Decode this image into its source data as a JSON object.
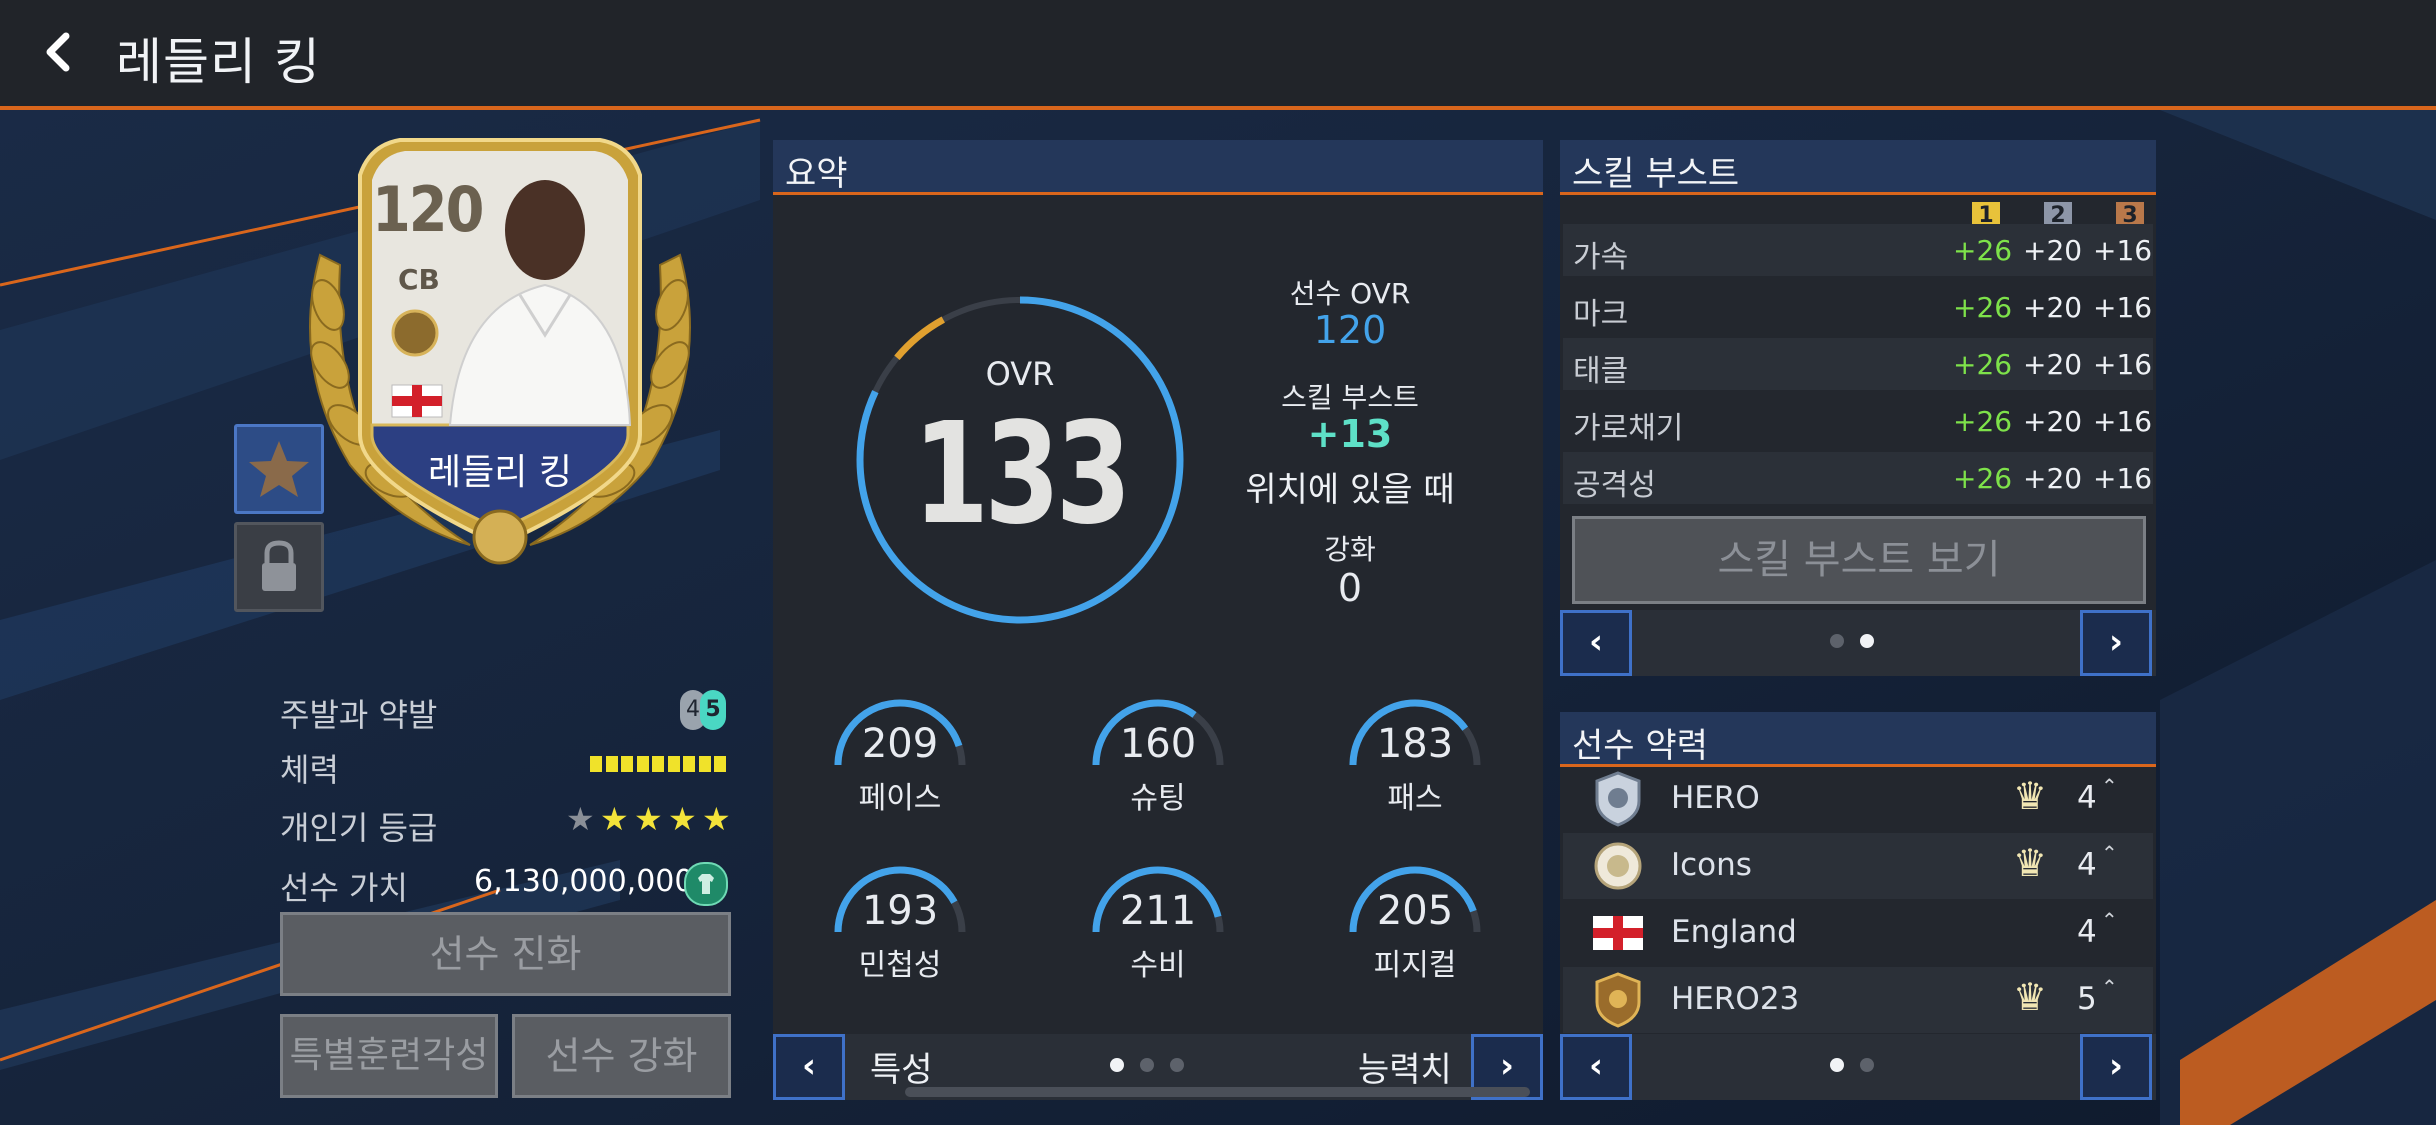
{
  "header": {
    "title": "레들리 킹"
  },
  "card": {
    "rating": "120",
    "position": "CB",
    "name": "레들리 킹"
  },
  "player_info": {
    "foot_label": "주발과 약발",
    "foot_weak": "4",
    "foot_strong": "5",
    "stamina_label": "체력",
    "stamina_blocks": 9,
    "popularity_label": "개인기 등급",
    "popularity_stars": 4,
    "popularity_max": 5,
    "value_label": "선수 가치",
    "value": "6,130,000,000"
  },
  "buttons": {
    "evolve": "선수 진화",
    "special_training": "특별훈련각성",
    "enhance": "선수 강화",
    "skill_boost_view": "스킬 부스트 보기"
  },
  "summary": {
    "title": "요약",
    "ovr_label": "OVR",
    "ovr_value": "133",
    "ovr_fraction": 0.95,
    "player_ovr_label": "선수 OVR",
    "player_ovr_value": "120",
    "skill_boost_label": "스킬 부스트",
    "skill_boost_value": "+13",
    "position_note": "위치에 있을 때",
    "enhance_label": "강화",
    "enhance_value": "0",
    "stats": [
      {
        "value": "209",
        "label": "페이스",
        "fill": 0.9
      },
      {
        "value": "160",
        "label": "슈팅",
        "fill": 0.7
      },
      {
        "value": "183",
        "label": "패스",
        "fill": 0.8
      },
      {
        "value": "193",
        "label": "민첩성",
        "fill": 0.84
      },
      {
        "value": "211",
        "label": "수비",
        "fill": 0.92
      },
      {
        "value": "205",
        "label": "피지컬",
        "fill": 0.89
      }
    ],
    "nav_left_label": "특성",
    "nav_right_label": "능력치",
    "page_dots": 3,
    "page_active": 0
  },
  "skill_boost": {
    "title": "스킬 부스트",
    "levels": [
      "1",
      "2",
      "3"
    ],
    "level_colors": [
      "#e8c23a",
      "#8d96a8",
      "#b9784a"
    ],
    "rows": [
      {
        "label": "가속",
        "v1": "+26",
        "v2": "+20",
        "v3": "+16"
      },
      {
        "label": "마크",
        "v1": "+26",
        "v2": "+20",
        "v3": "+16"
      },
      {
        "label": "태클",
        "v1": "+26",
        "v2": "+20",
        "v3": "+16"
      },
      {
        "label": "가로채기",
        "v1": "+26",
        "v2": "+20",
        "v3": "+16"
      },
      {
        "label": "공격성",
        "v1": "+26",
        "v2": "+20",
        "v3": "+16"
      }
    ],
    "page_dots": 2,
    "page_active": 1
  },
  "chemistry": {
    "title": "선수 약력",
    "rows": [
      {
        "icon": "hero-badge-icon",
        "name": "HERO",
        "count": "4",
        "crown": true
      },
      {
        "icon": "icons-badge-icon",
        "name": "Icons",
        "count": "4",
        "crown": true
      },
      {
        "icon": "england-flag-icon",
        "name": "England",
        "count": "4",
        "crown": false
      },
      {
        "icon": "hero23-badge-icon",
        "name": "HERO23",
        "count": "5",
        "crown": true
      }
    ],
    "page_dots": 2,
    "page_active": 0
  },
  "colors": {
    "accent_orange": "#d9661c",
    "ring_blue": "#43a3ea",
    "ring_gold": "#e0a02f",
    "boost_green": "#7ee24a",
    "boost_teal": "#5ee0c7",
    "nav_blue": "#3f71c8"
  }
}
